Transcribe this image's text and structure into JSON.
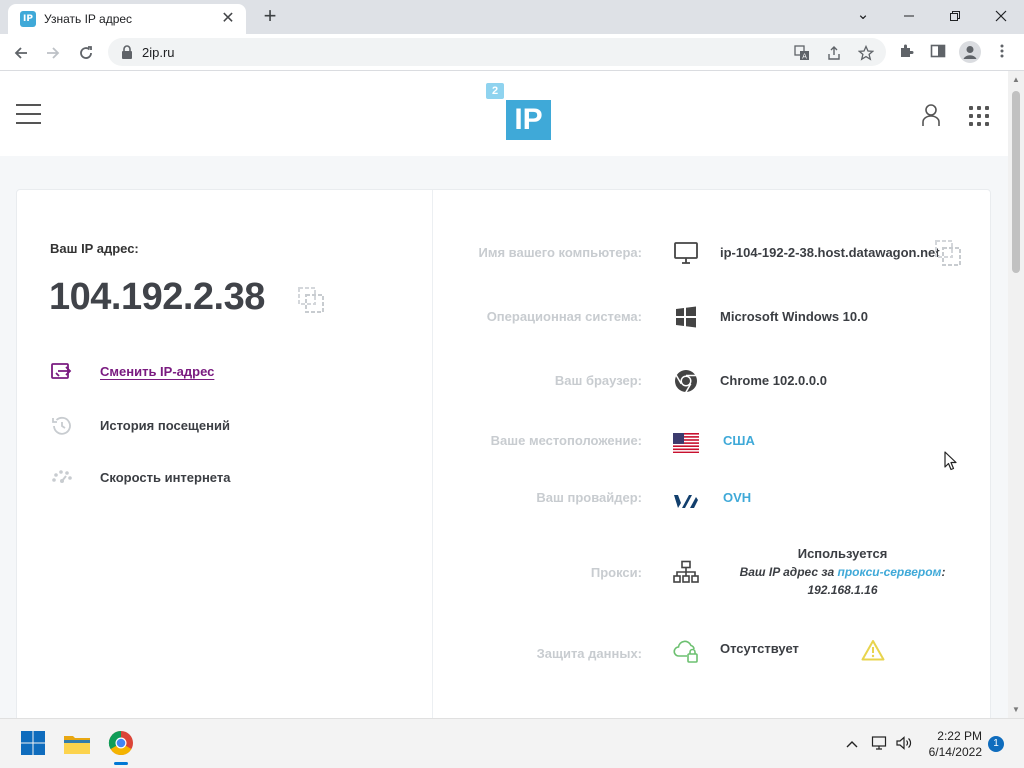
{
  "browser": {
    "tab_title": "Узнать IP адрес",
    "tab_favicon": "IP",
    "new_tab": "+",
    "url": "2ip.ru",
    "window_controls": {
      "minimize": "—",
      "restore": "❐",
      "close": "✕",
      "tab_list": "⌄"
    }
  },
  "site": {
    "logo_badge": "2",
    "logo_text": "IP"
  },
  "main": {
    "ip_label": "Ваш IP адрес:",
    "ip_value": "104.192.2.38",
    "actions": [
      {
        "label": "Сменить IP-адрес",
        "icon": "change-ip-icon"
      },
      {
        "label": "История посещений",
        "icon": "history-icon"
      },
      {
        "label": "Скорость интернета",
        "icon": "speed-icon"
      }
    ]
  },
  "info": {
    "computer_name": {
      "label": "Имя вашего компьютера:",
      "value": "ip-104-192-2-38.host.datawagon.net"
    },
    "os": {
      "label": "Операционная система:",
      "value": "Microsoft Windows 10.0"
    },
    "browser": {
      "label": "Ваш браузер:",
      "value": "Chrome 102.0.0.0"
    },
    "location": {
      "label": "Ваше местоположение:",
      "value": "США"
    },
    "provider": {
      "label": "Ваш провайдер:",
      "value": "OVH"
    },
    "proxy": {
      "label": "Прокси:",
      "status": "Используется",
      "text_before": "Ваш IP адрес за ",
      "link": "прокси-сервером",
      "text_after": ":",
      "ip": "192.168.1.16"
    },
    "protection": {
      "label": "Защита данных:",
      "value": "Отсутствует"
    }
  },
  "taskbar": {
    "time": "2:22 PM",
    "date": "6/14/2022",
    "notifications": "1"
  },
  "colors": {
    "accent": "#3fa9d8",
    "link_purple": "#7a1b80",
    "warning": "#e8d44d",
    "shield_green": "#6cc070"
  }
}
